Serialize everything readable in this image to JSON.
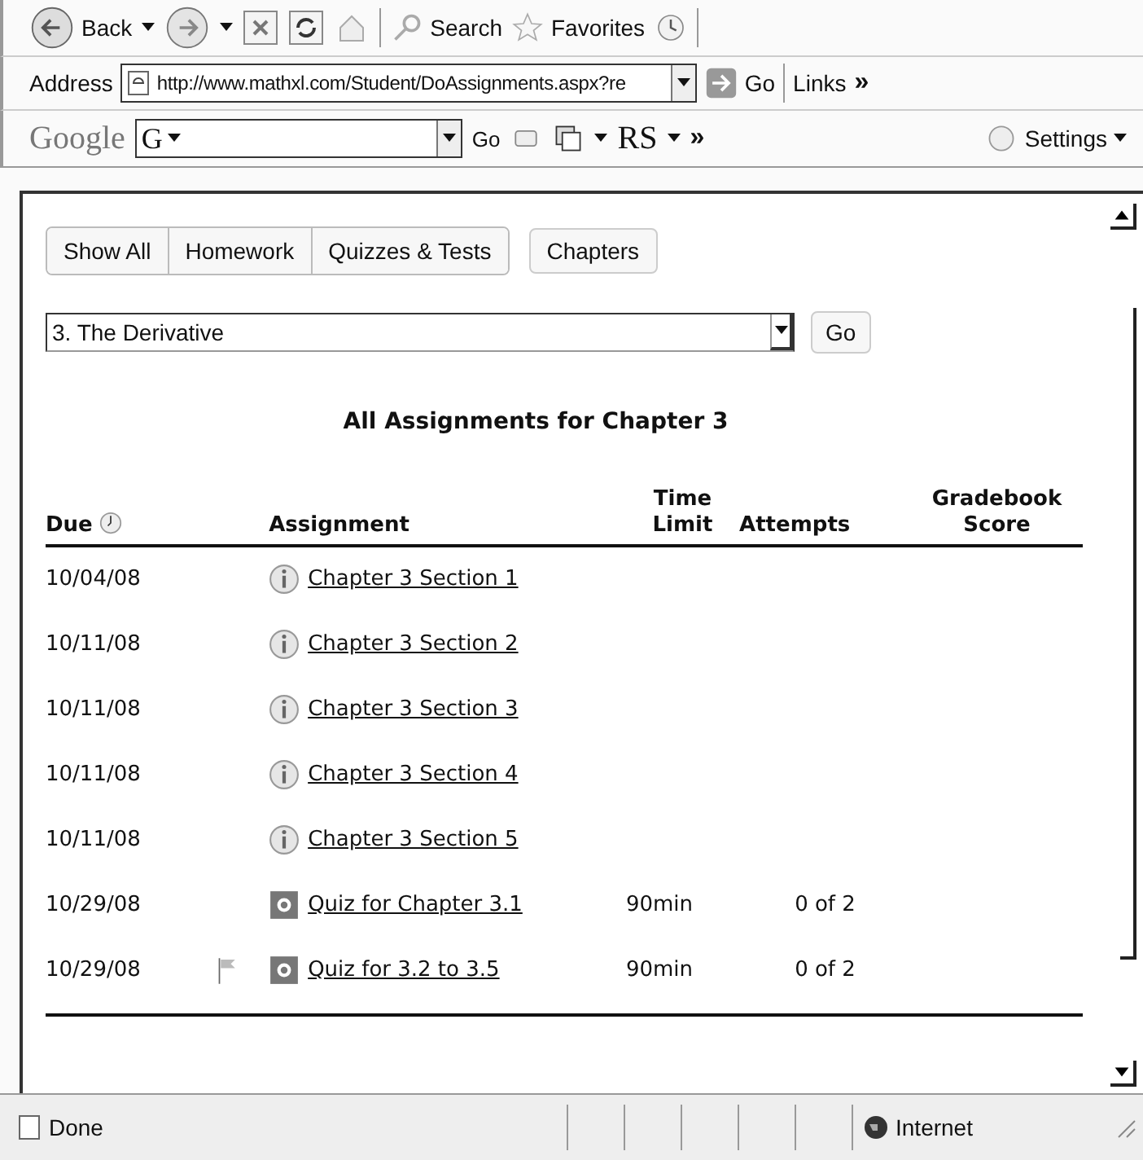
{
  "toolbar": {
    "back": "Back",
    "search": "Search",
    "favorites": "Favorites"
  },
  "address_bar": {
    "label": "Address",
    "value": "http://www.mathxl.com/Student/DoAssignments.aspx?re",
    "go": "Go",
    "links": "Links",
    "more": "»"
  },
  "google_bar": {
    "logo": "Google",
    "field": "G",
    "go": "Go",
    "rs": "RS",
    "more": "»",
    "settings": "Settings"
  },
  "tabs": [
    {
      "label": "Show All",
      "selected": false
    },
    {
      "label": "Homework",
      "selected": false
    },
    {
      "label": "Quizzes & Tests",
      "selected": false
    }
  ],
  "chapters_button": "Chapters",
  "chapter_select": {
    "value": "3. The Derivative",
    "go": "Go"
  },
  "heading": "All Assignments for Chapter 3",
  "table": {
    "columns": [
      "Due",
      "Assignment",
      "Time Limit",
      "Attempts",
      "Gradebook Score"
    ],
    "rows": [
      {
        "due": "10/04/08",
        "kind": "info",
        "flagged": false,
        "assignment": "Chapter 3 Section 1"
      },
      {
        "due": "10/11/08",
        "kind": "info",
        "flagged": false,
        "assignment": "Chapter 3 Section 2"
      },
      {
        "due": "10/11/08",
        "kind": "info",
        "flagged": false,
        "assignment": "Chapter 3 Section 3"
      },
      {
        "due": "10/11/08",
        "kind": "info",
        "flagged": false,
        "assignment": "Chapter 3 Section 4"
      },
      {
        "due": "10/11/08",
        "kind": "info",
        "flagged": false,
        "assignment": "Chapter 3 Section 5"
      },
      {
        "due": "10/29/08",
        "kind": "quiz",
        "flagged": false,
        "assignment": "Quiz for Chapter 3.1",
        "time_limit": "90min",
        "attempts": "0 of 2"
      },
      {
        "due": "10/29/08",
        "kind": "quiz",
        "flagged": true,
        "assignment": "Quiz for 3.2 to 3.5",
        "time_limit": "90min",
        "attempts": "0 of 2"
      }
    ]
  },
  "status_bar": {
    "status": "Done",
    "zone": "Internet"
  }
}
